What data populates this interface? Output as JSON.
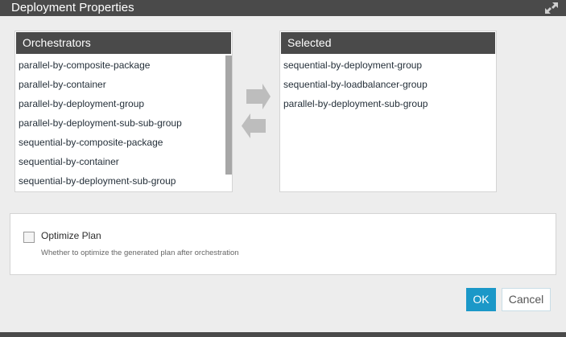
{
  "dialog": {
    "title": "Deployment Properties"
  },
  "orchestrators": {
    "header": "Orchestrators",
    "items": [
      "parallel-by-composite-package",
      "parallel-by-container",
      "parallel-by-deployment-group",
      "parallel-by-deployment-sub-sub-group",
      "sequential-by-composite-package",
      "sequential-by-container",
      "sequential-by-deployment-sub-group"
    ]
  },
  "selected": {
    "header": "Selected",
    "items": [
      "sequential-by-deployment-group",
      "sequential-by-loadbalancer-group",
      "parallel-by-deployment-sub-group"
    ]
  },
  "options": {
    "optimize_label": "Optimize Plan",
    "optimize_description": "Whether to optimize the generated plan after orchestration",
    "optimize_checked": false
  },
  "buttons": {
    "ok": "OK",
    "cancel": "Cancel"
  },
  "icons": {
    "expand": "expand-icon",
    "move_right": "arrow-right-icon",
    "move_left": "arrow-left-icon"
  },
  "colors": {
    "header_bg": "#4a4a4a",
    "primary_button": "#1b98c8",
    "arrow": "#bdbdbd"
  }
}
